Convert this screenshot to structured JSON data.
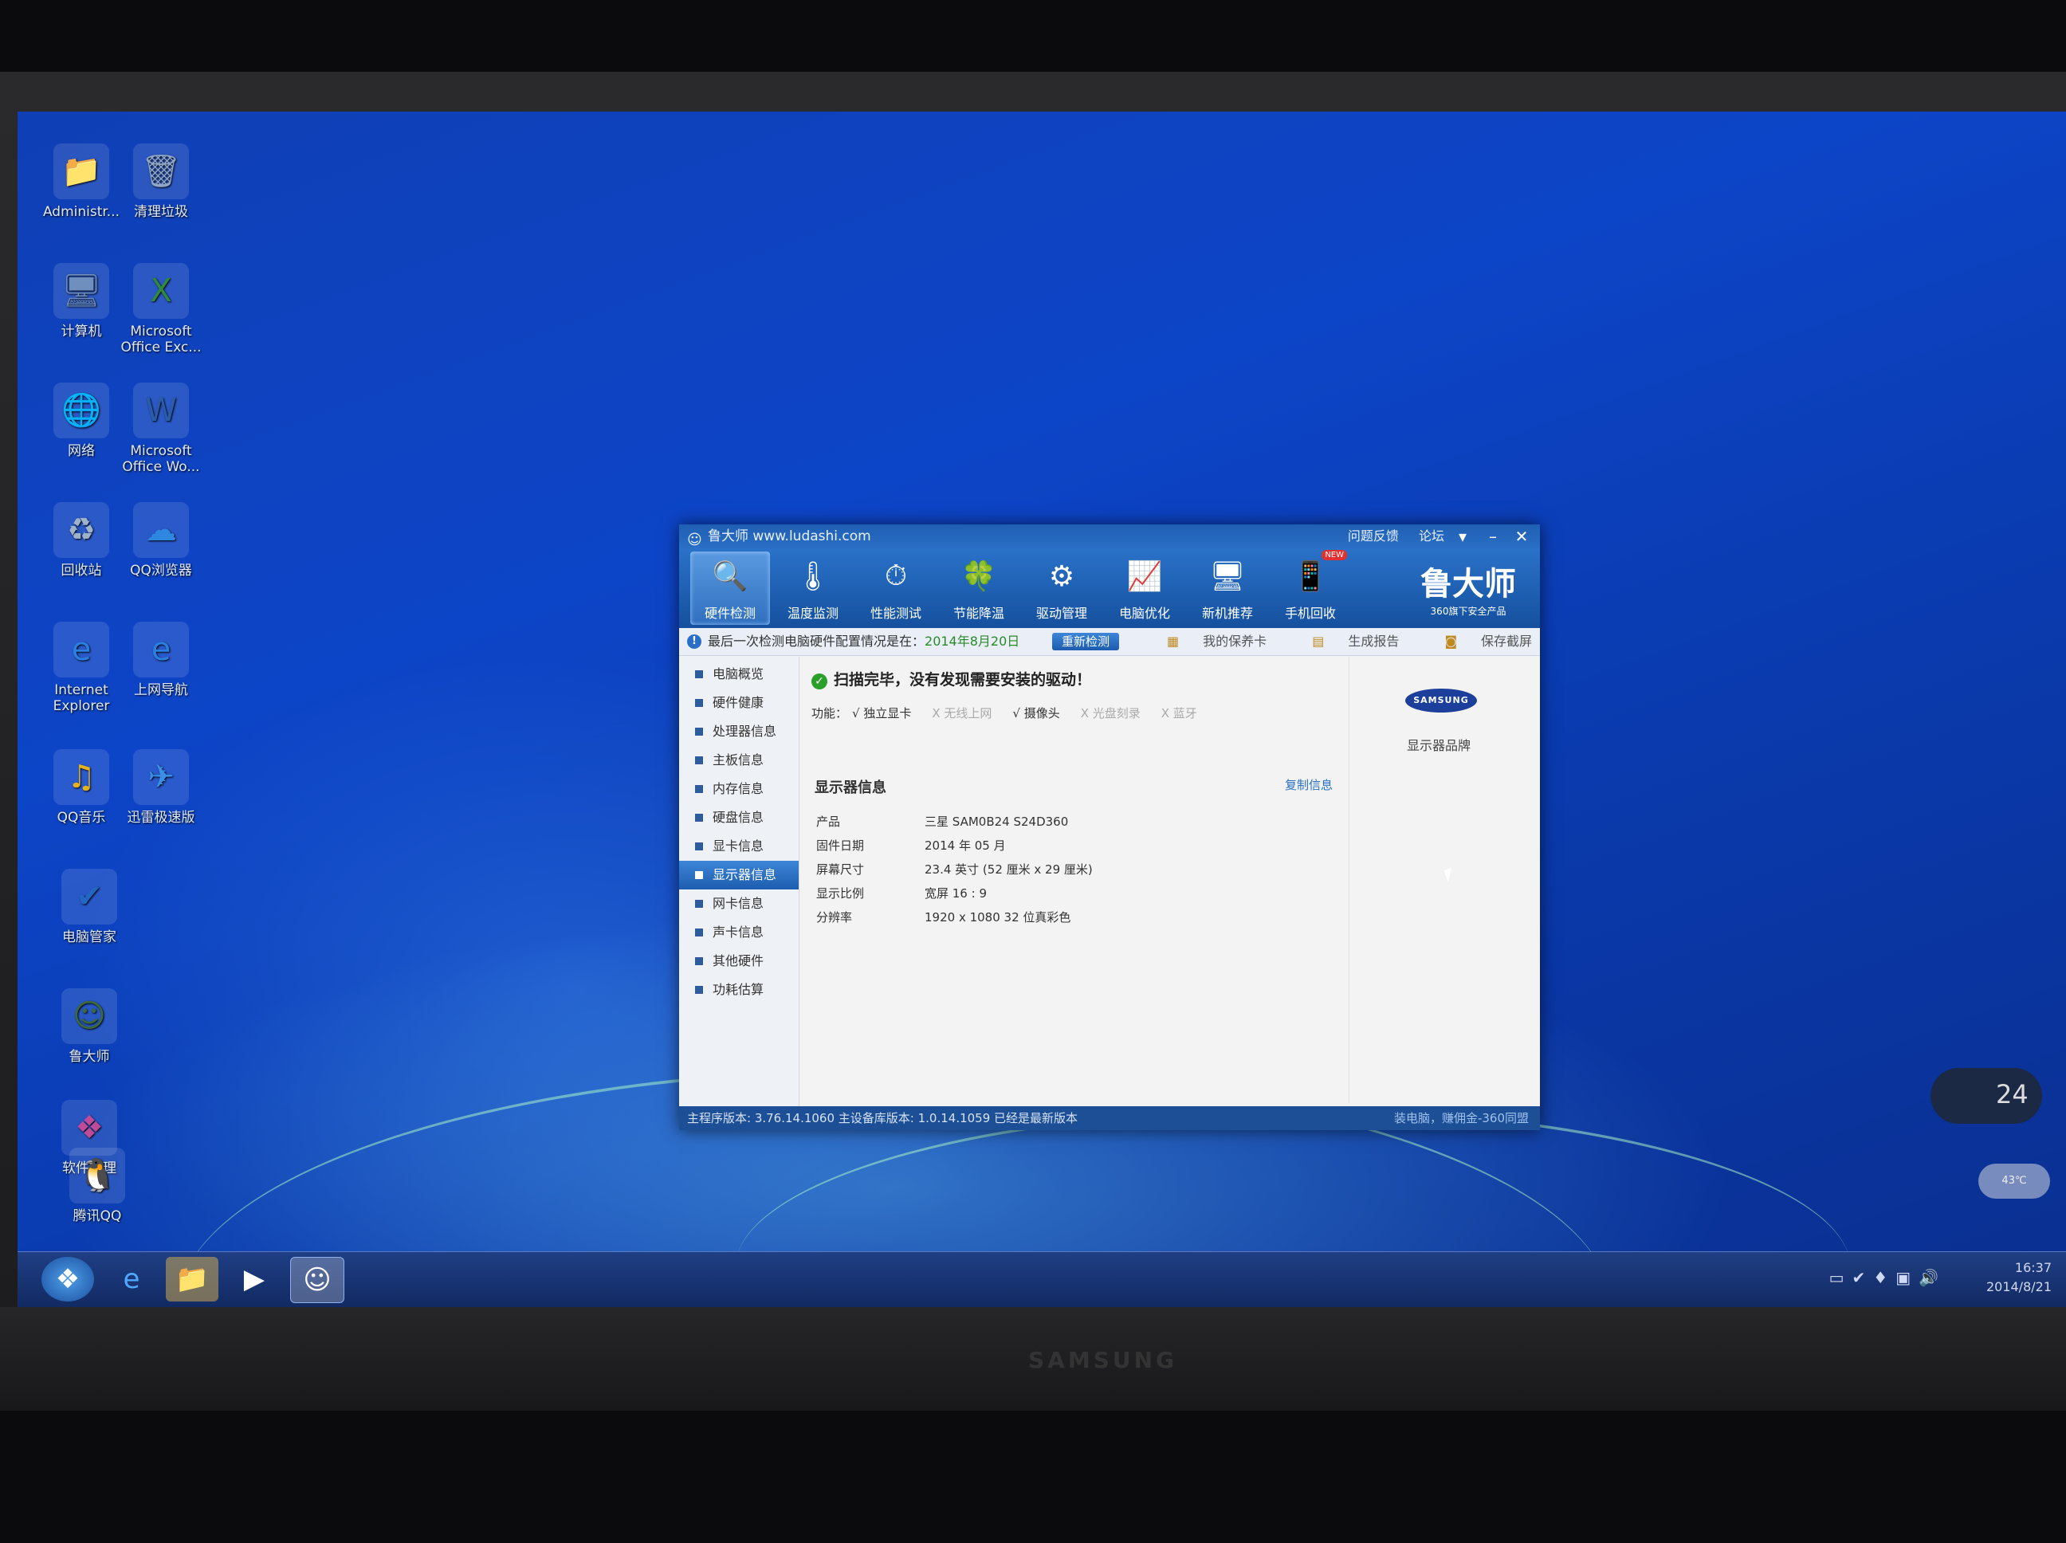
{
  "desktop": {
    "icons": [
      {
        "label": "Administr...",
        "glyph": "📁",
        "color": "#e6b84a"
      },
      {
        "label": "清理垃圾",
        "glyph": "🗑",
        "color": "#8fa6c8"
      },
      {
        "label": "计算机",
        "glyph": "🖥",
        "color": "#6f8fbf"
      },
      {
        "label": "Microsoft Office Exc...",
        "glyph": "X",
        "color": "#2f8a3a"
      },
      {
        "label": "网络",
        "glyph": "🌐",
        "color": "#4c8fd8"
      },
      {
        "label": "Microsoft Office Wo...",
        "glyph": "W",
        "color": "#2b5cab"
      },
      {
        "label": "回收站",
        "glyph": "♻",
        "color": "#9fb2cc"
      },
      {
        "label": "QQ浏览器",
        "glyph": "☁",
        "color": "#2f86e0"
      },
      {
        "label": "Internet Explorer",
        "glyph": "e",
        "color": "#2a7fe0"
      },
      {
        "label": "上网导航",
        "glyph": "e",
        "color": "#2a7fe0"
      },
      {
        "label": "QQ音乐",
        "glyph": "♫",
        "color": "#e3b21f"
      },
      {
        "label": "迅雷极速版",
        "glyph": "✈",
        "color": "#3a8ee6"
      },
      {
        "label": "电脑管家",
        "glyph": "✔",
        "color": "#2466c4"
      },
      {
        "label": "鲁大师",
        "glyph": "☺",
        "color": "#3d6a3a"
      },
      {
        "label": "软件管理",
        "glyph": "❖",
        "color": "#c04a9a"
      },
      {
        "label": "腾讯QQ",
        "glyph": "🐧",
        "color": "#222"
      }
    ]
  },
  "window": {
    "title": "鲁大师 www.ludashi.com",
    "links": [
      "问题反馈",
      "论坛"
    ],
    "tools": [
      {
        "label": "硬件检测",
        "glyph": "🔍",
        "active": true
      },
      {
        "label": "温度监测",
        "glyph": "🌡",
        "active": false
      },
      {
        "label": "性能测试",
        "glyph": "⏱",
        "active": false
      },
      {
        "label": "节能降温",
        "glyph": "🍀",
        "active": false
      },
      {
        "label": "驱动管理",
        "glyph": "⚙",
        "active": false
      },
      {
        "label": "电脑优化",
        "glyph": "📈",
        "active": false
      },
      {
        "label": "新机推荐",
        "glyph": "🖥",
        "active": false
      },
      {
        "label": "手机回收",
        "glyph": "📱",
        "active": false
      }
    ],
    "new_badge": "NEW",
    "brand_name": "鲁大师",
    "brand_sub": "360旗下安全产品",
    "info_msg": "最后一次检测电脑硬件配置情况是在：",
    "info_date": "2014年8月20日",
    "recheck_label": "重新检测",
    "right_links": [
      "我的保养卡",
      "生成报告",
      "保存截屏"
    ],
    "sidebar": [
      "电脑概览",
      "硬件健康",
      "处理器信息",
      "主板信息",
      "内存信息",
      "硬盘信息",
      "显卡信息",
      "显示器信息",
      "网卡信息",
      "声卡信息",
      "其他硬件",
      "功耗估算"
    ],
    "sidebar_active": 7,
    "scan_result": "扫描完毕，没有发现需要安装的驱动！",
    "funcs_label": "功能：",
    "funcs": [
      {
        "text": "√ 独立显卡",
        "on": true
      },
      {
        "text": "X 无线上网",
        "on": false
      },
      {
        "text": "√ 摄像头",
        "on": true
      },
      {
        "text": "X 光盘刻录",
        "on": false
      },
      {
        "text": "X 蓝牙",
        "on": false
      }
    ],
    "section_title": "显示器信息",
    "copy_label": "复制信息",
    "details": [
      {
        "k": "产品",
        "v": "三星 SAM0B24 S24D360"
      },
      {
        "k": "固件日期",
        "v": "2014 年 05 月"
      },
      {
        "k": "屏幕尺寸",
        "v": "23.4 英寸 (52 厘米 x 29 厘米)"
      },
      {
        "k": "显示比例",
        "v": "宽屏 16 : 9"
      },
      {
        "k": "分辨率",
        "v": "1920 x 1080 32 位真彩色"
      }
    ],
    "brand_logo": "SAMSUNG",
    "brand_label": "显示器品牌",
    "status_left": "主程序版本: 3.76.14.1060   主设备库版本: 1.0.14.1059   已经是最新版本",
    "status_right": "装电脑，赚佣金-360同盟"
  },
  "gadget": {
    "temp": "24",
    "small": "43℃"
  },
  "taskbar": {
    "time": "16:37",
    "date": "2014/8/21"
  },
  "monitor_brand": "SAMSUNG"
}
